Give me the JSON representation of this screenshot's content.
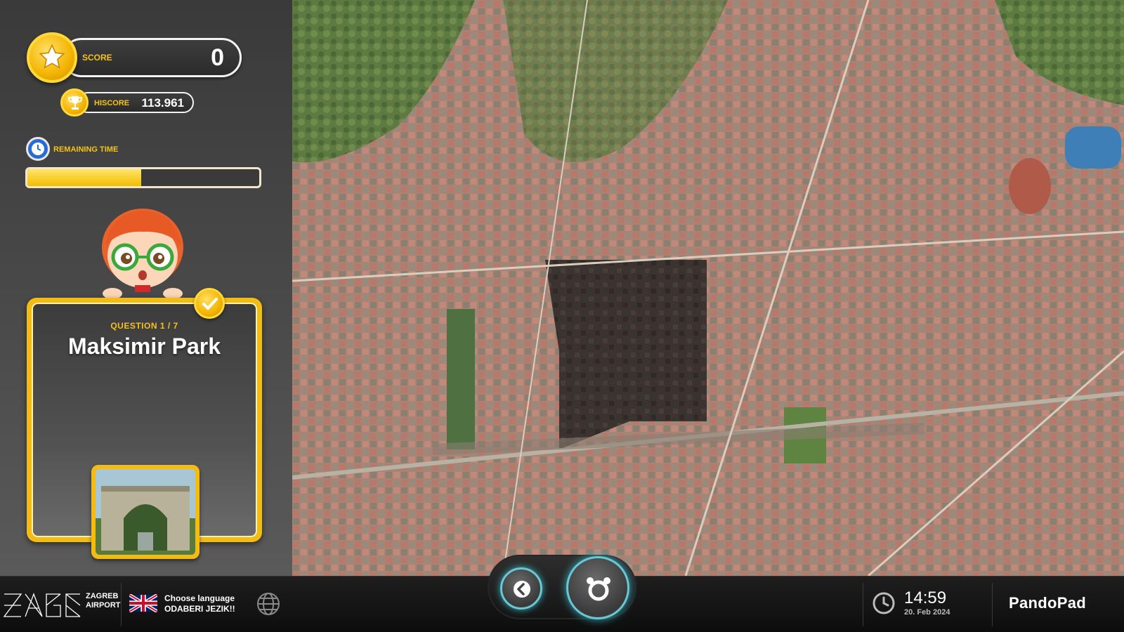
{
  "score": {
    "label": "SCORE",
    "value": "0"
  },
  "hiscore": {
    "label": "HISCORE",
    "value": "113.961"
  },
  "timer": {
    "label": "REMAINING TIME",
    "progress": 0.49
  },
  "question": {
    "number_label": "QUESTION 1 / 7",
    "title": "Maksimir Park"
  },
  "airport": {
    "line1": "ZAGREB",
    "line2": "AIRPORT"
  },
  "language": {
    "line1": "Choose language",
    "line2": "ODABERI JEZIK!!"
  },
  "clock": {
    "time": "14:59",
    "date": "20. Feb 2024"
  },
  "brand": "PandoPad",
  "colors": {
    "accent_gold": "#f3bc15",
    "label_gold": "#f5c21b",
    "nav_glow": "#68c9d4",
    "clock_blue": "#2a6bd1"
  },
  "icons": [
    "star-icon",
    "trophy-icon",
    "clock-icon",
    "check-icon",
    "chevron-left-icon",
    "pandopad-logo-icon",
    "globe-icon",
    "uk-flag-icon"
  ]
}
